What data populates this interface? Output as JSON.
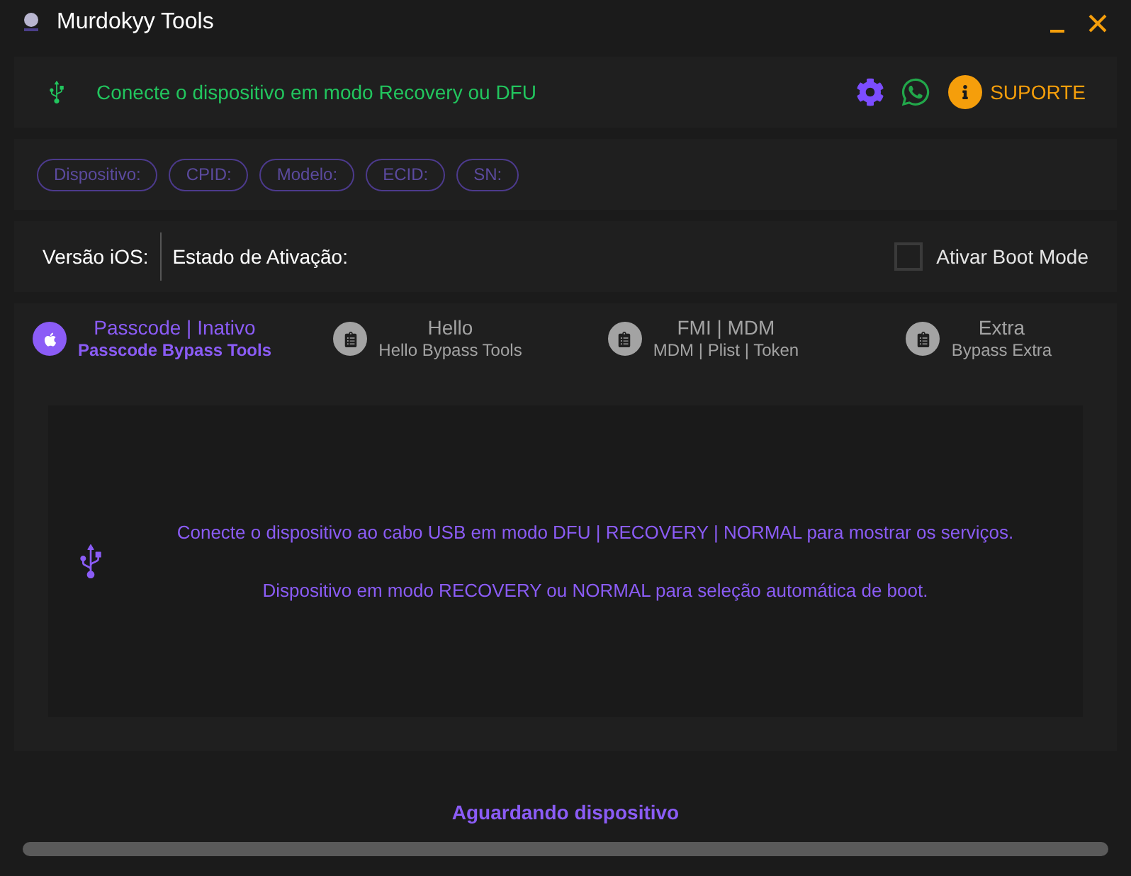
{
  "window": {
    "title": "Murdokyy Tools"
  },
  "header": {
    "status": "Conecte o dispositivo em modo Recovery ou DFU",
    "support": "SUPORTE"
  },
  "chips": [
    "Dispositivo:",
    "CPID:",
    "Modelo:",
    "ECID:",
    "SN:"
  ],
  "info": {
    "ios_version": "Versão iOS:",
    "activation": "Estado de Ativação:",
    "boot_mode": {
      "label": "Ativar Boot Mode",
      "checked": false
    }
  },
  "tabs": [
    {
      "title": "Passcode | Inativo",
      "subtitle": "Passcode Bypass Tools",
      "kind": "apple",
      "selected": true
    },
    {
      "title": "Hello",
      "subtitle": "Hello Bypass Tools",
      "kind": "clipboard",
      "selected": false
    },
    {
      "title": "FMI | MDM",
      "subtitle": "MDM | Plist | Token",
      "kind": "clipboard",
      "selected": false
    },
    {
      "title": "Extra",
      "subtitle": "Bypass Extra",
      "kind": "clipboard",
      "selected": false
    }
  ],
  "content": {
    "messages": [
      "Conecte o dispositivo ao cabo USB em modo DFU | RECOVERY | NORMAL para mostrar os serviços.",
      "Dispositivo em modo RECOVERY ou NORMAL para seleção automática de boot."
    ]
  },
  "status": {
    "text": "Aguardando dispositivo",
    "level": 0
  }
}
